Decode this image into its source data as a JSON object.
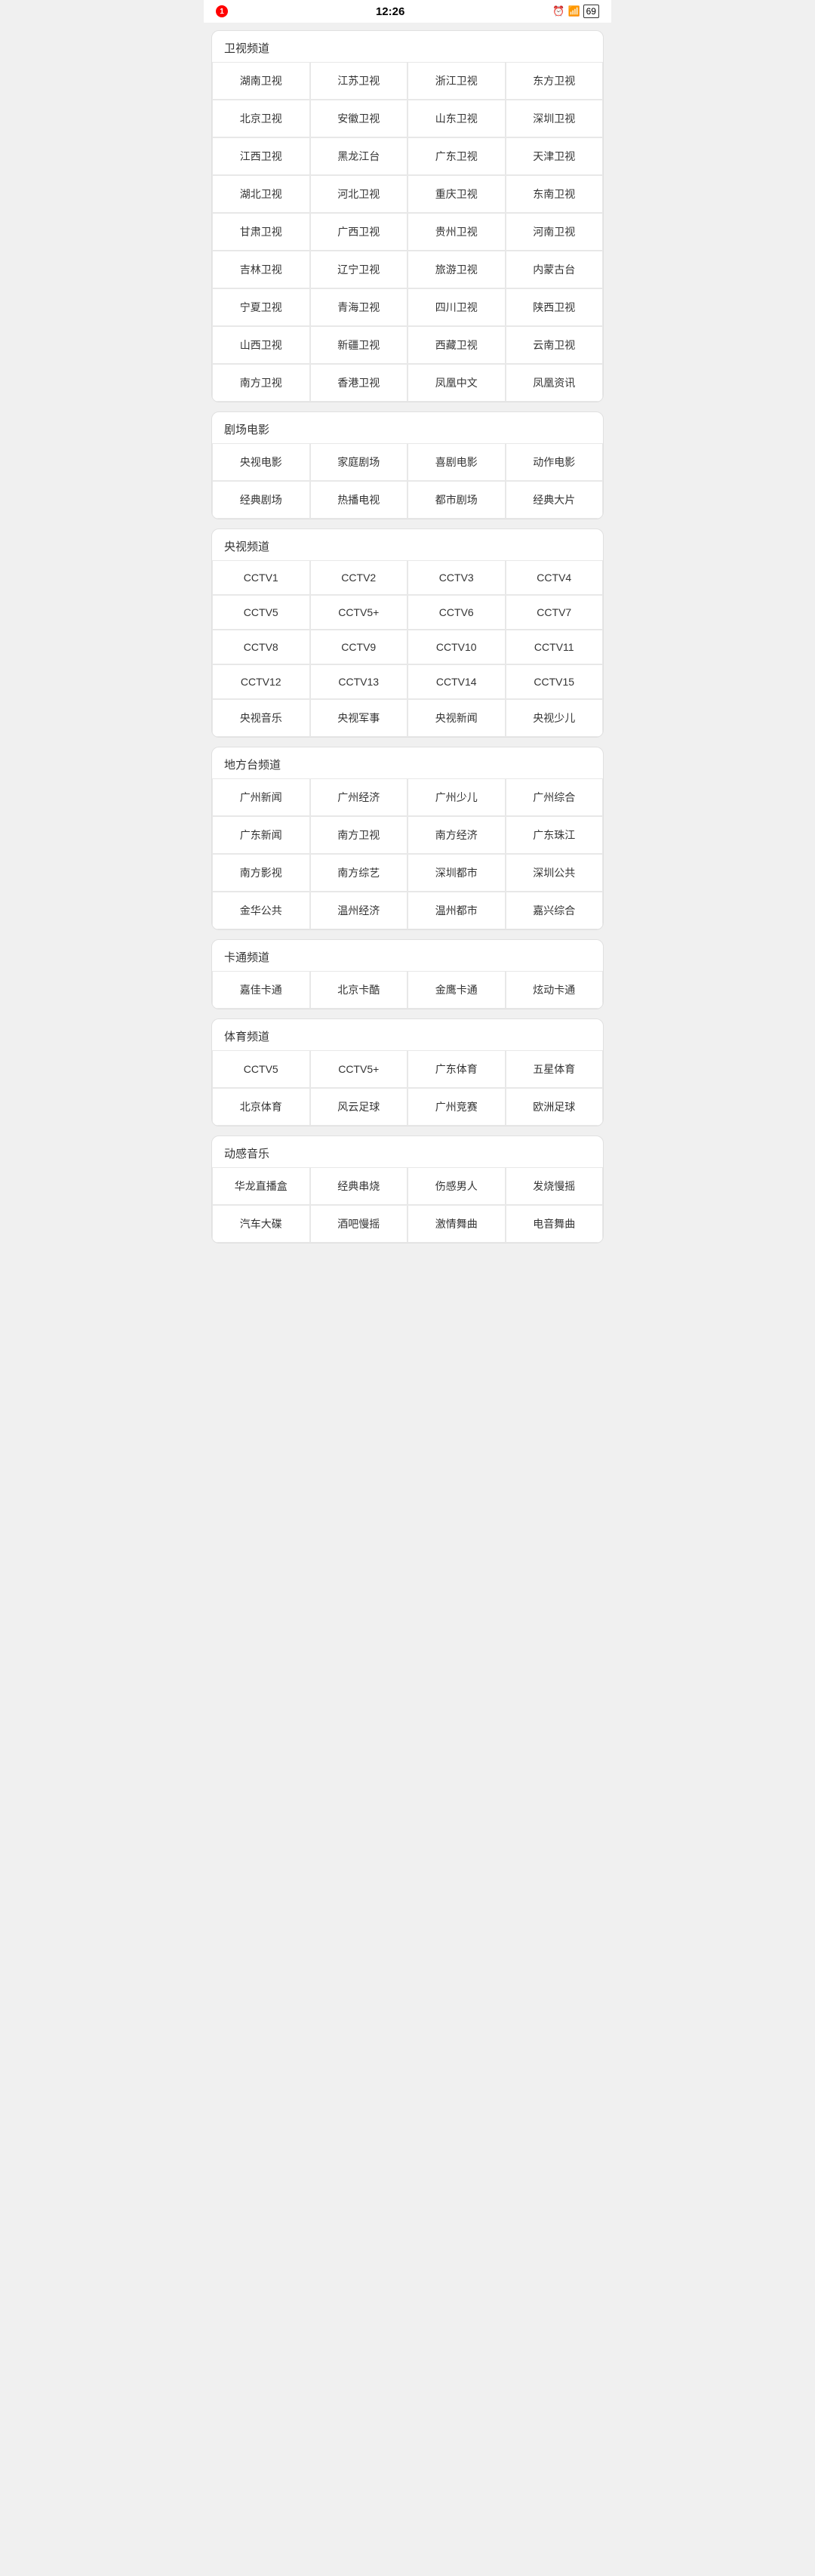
{
  "statusBar": {
    "time": "12:26",
    "notification": "1",
    "battery": "69"
  },
  "sections": [
    {
      "id": "satellite",
      "title": "卫视频道",
      "items": [
        "湖南卫视",
        "江苏卫视",
        "浙江卫视",
        "东方卫视",
        "北京卫视",
        "安徽卫视",
        "山东卫视",
        "深圳卫视",
        "江西卫视",
        "黑龙江台",
        "广东卫视",
        "天津卫视",
        "湖北卫视",
        "河北卫视",
        "重庆卫视",
        "东南卫视",
        "甘肃卫视",
        "广西卫视",
        "贵州卫视",
        "河南卫视",
        "吉林卫视",
        "辽宁卫视",
        "旅游卫视",
        "内蒙古台",
        "宁夏卫视",
        "青海卫视",
        "四川卫视",
        "陕西卫视",
        "山西卫视",
        "新疆卫视",
        "西藏卫视",
        "云南卫视",
        "南方卫视",
        "香港卫视",
        "凤凰中文",
        "凤凰资讯"
      ]
    },
    {
      "id": "drama",
      "title": "剧场电影",
      "items": [
        "央视电影",
        "家庭剧场",
        "喜剧电影",
        "动作电影",
        "经典剧场",
        "热播电视",
        "都市剧场",
        "经典大片"
      ]
    },
    {
      "id": "cctv",
      "title": "央视频道",
      "items": [
        "CCTV1",
        "CCTV2",
        "CCTV3",
        "CCTV4",
        "CCTV5",
        "CCTV5+",
        "CCTV6",
        "CCTV7",
        "CCTV8",
        "CCTV9",
        "CCTV10",
        "CCTV11",
        "CCTV12",
        "CCTV13",
        "CCTV14",
        "CCTV15",
        "央视音乐",
        "央视军事",
        "央视新闻",
        "央视少儿"
      ]
    },
    {
      "id": "local",
      "title": "地方台频道",
      "items": [
        "广州新闻",
        "广州经济",
        "广州少儿",
        "广州综合",
        "广东新闻",
        "南方卫视",
        "南方经济",
        "广东珠江",
        "南方影视",
        "南方综艺",
        "深圳都市",
        "深圳公共",
        "金华公共",
        "温州经济",
        "温州都市",
        "嘉兴综合"
      ]
    },
    {
      "id": "cartoon",
      "title": "卡通频道",
      "items": [
        "嘉佳卡通",
        "北京卡酷",
        "金鹰卡通",
        "炫动卡通"
      ]
    },
    {
      "id": "sports",
      "title": "体育频道",
      "items": [
        "CCTV5",
        "CCTV5+",
        "广东体育",
        "五星体育",
        "北京体育",
        "风云足球",
        "广州竞赛",
        "欧洲足球"
      ]
    },
    {
      "id": "music",
      "title": "动感音乐",
      "items": [
        "华龙直播盒",
        "经典串烧",
        "伤感男人",
        "发烧慢摇",
        "汽车大碟",
        "酒吧慢摇",
        "激情舞曲",
        "电音舞曲"
      ]
    }
  ]
}
